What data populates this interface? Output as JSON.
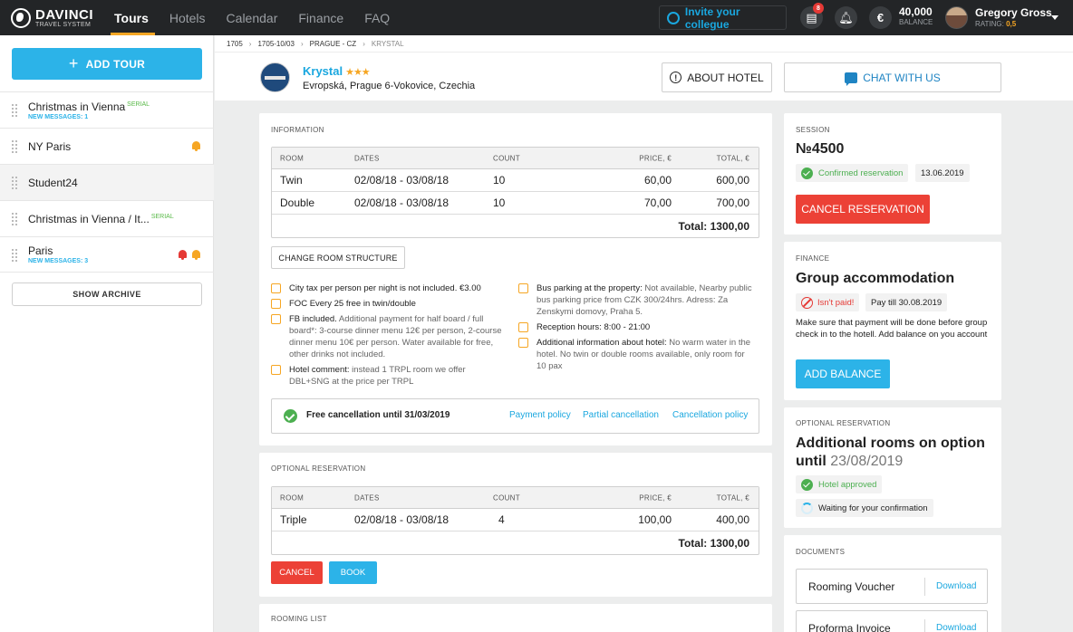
{
  "topbar": {
    "logo_title": "DAVINCI",
    "logo_subtitle": "TRAVEL SYSTEM",
    "nav": [
      "Tours",
      "Hotels",
      "Calendar",
      "Finance",
      "FAQ"
    ],
    "active_nav": "Tours",
    "invite_label": "Invite your collegue",
    "messages_badge": "8",
    "balance_value": "40,000",
    "balance_label": "BALANCE",
    "user_name": "Gregory Gross",
    "rating_label": "RATING:",
    "rating_value": "0,5",
    "accent": "#f6a623"
  },
  "sidebar": {
    "add_tour_label": "ADD TOUR",
    "tours": [
      {
        "name": "Christmas in Vienna",
        "tag": "SERIAL",
        "sub": "NEW MESSAGES: 1",
        "bells": []
      },
      {
        "name": "NY Paris",
        "tag": "",
        "sub": "",
        "bells": [
          "#f6a623"
        ]
      },
      {
        "name": "Student24",
        "tag": "",
        "sub": "",
        "bells": [],
        "selected": true
      },
      {
        "name": "Christmas in Vienna / It...",
        "tag": "SERIAL",
        "sub": "",
        "bells": []
      },
      {
        "name": "Paris",
        "tag": "",
        "sub": "NEW MESSAGES: 3",
        "bells": [
          "#e53935",
          "#f6a623"
        ]
      }
    ],
    "show_archive_label": "SHOW ARCHIVE"
  },
  "breadcrumb": [
    "1705",
    "1705-10/03",
    "PRAGUE - CZ",
    "KRYSTAL"
  ],
  "hotel": {
    "name": "Krystal",
    "stars": "★★★",
    "address": "Evropská, Prague 6-Vokovice, Czechia",
    "about_label": "ABOUT HOTEL",
    "chat_label": "CHAT WITH US"
  },
  "information": {
    "title": "INFORMATION",
    "columns": [
      "ROOM",
      "DATES",
      "COUNT",
      "PRICE, €",
      "TOTAL, €"
    ],
    "rows": [
      {
        "room": "Twin",
        "dates": "02/08/18 - 03/08/18",
        "count": "10",
        "price": "60,00",
        "total": "600,00"
      },
      {
        "room": "Double",
        "dates": "02/08/18 - 03/08/18",
        "count": "10",
        "price": "70,00",
        "total": "700,00"
      }
    ],
    "total": "Total: 1300,00",
    "change_label": "CHANGE ROOM STRUCTURE",
    "notes_left": [
      {
        "icon": "tax-icon",
        "bold": "City tax per person per night is not included. €3.00",
        "text": ""
      },
      {
        "icon": "person-icon",
        "bold": "FOC Every 25 free in twin/double",
        "text": ""
      },
      {
        "icon": "cutlery-icon",
        "bold": "FB included.",
        "text": " Additional payment for half board / full board*: 3-course dinner menu 12€ per person, 2-course dinner menu 10€ per person. Water available for free, other drinks not included."
      },
      {
        "icon": "comment-icon",
        "bold": "Hotel comment:",
        "text": " instead 1 TRPL room we offer DBL+SNG at the price per TRPL"
      }
    ],
    "notes_right": [
      {
        "icon": "bus-icon",
        "bold": "Bus parking at the property:",
        "text": " Not available, Nearby public bus parking price from CZK 300/24hrs. Adress: Za Zenskymi domovy, Praha 5."
      },
      {
        "icon": "reception-icon",
        "bold": "Reception hours: 8:00 - 21:00",
        "text": ""
      },
      {
        "icon": "info-icon",
        "bold": "Additional information about hotel:",
        "text": " No warm water in the hotel. No twin or double rooms available, only room for 10 pax"
      }
    ],
    "free_cancellation": "Free cancellation until 31/03/2019",
    "links": [
      "Payment policy",
      "Partial cancellation",
      "Cancellation policy"
    ]
  },
  "optional": {
    "title": "OPTIONAL RESERVATION",
    "columns": [
      "ROOM",
      "DATES",
      "COUNT",
      "PRICE, €",
      "TOTAL, €"
    ],
    "rows": [
      {
        "room": "Triple",
        "dates": "02/08/18 - 03/08/18",
        "count": "4",
        "price": "100,00",
        "total": "400,00"
      }
    ],
    "total": "Total: 1300,00",
    "cancel_label": "CANCEL",
    "book_label": "BOOK"
  },
  "rooming": {
    "title": "ROOMING LIST"
  },
  "session": {
    "title": "SESSION",
    "number": "№4500",
    "status": "Confirmed reservation",
    "date": "13.06.2019",
    "cancel_label": "CANCEL RESERVATION"
  },
  "finance": {
    "title": "FINANCE",
    "heading": "Group accommodation",
    "status": "Isn't paid!",
    "pay_till": "Pay till 30.08.2019",
    "note": "Make sure that payment will be done before group check in to the hotell. Add balance on you account",
    "add_balance_label": "ADD BALANCE"
  },
  "optional_right": {
    "title": "OPTIONAL RESERVATION",
    "heading_main": "Additional rooms on option until",
    "heading_date": "23/08/2019",
    "status_approved": "Hotel approved",
    "status_waiting": "Waiting for your confirmation"
  },
  "documents": {
    "title": "DOCUMENTS",
    "items": [
      {
        "name": "Rooming Voucher",
        "action": "Download"
      },
      {
        "name": "Proforma Invoice",
        "action": "Download"
      }
    ]
  }
}
